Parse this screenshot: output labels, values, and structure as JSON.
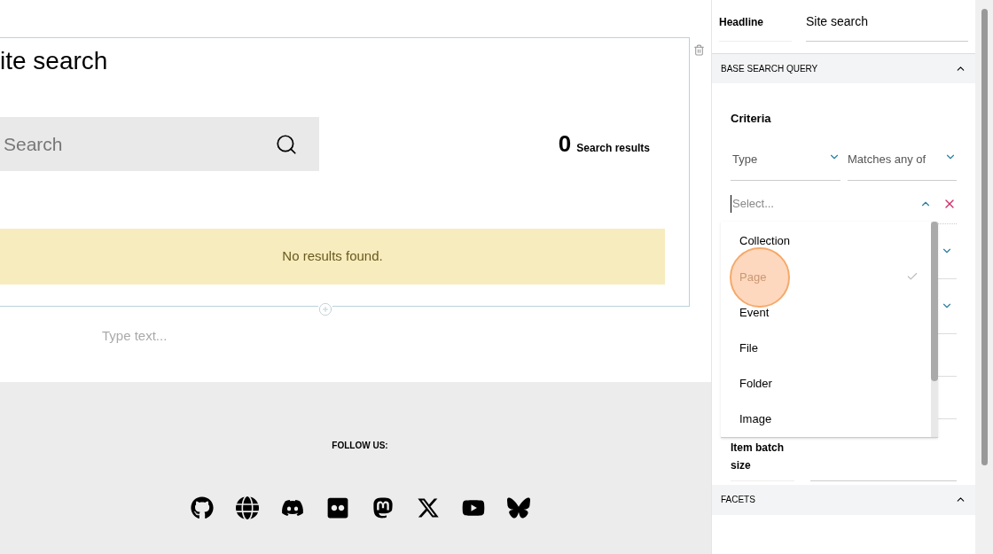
{
  "block": {
    "title": "ite search",
    "search": {
      "placeholder": "Search"
    },
    "result_count": "0",
    "result_label": "Search results",
    "empty_message": "No results found.",
    "text_placeholder": "Type text..."
  },
  "footer": {
    "follow_label": "FOLLOW US:",
    "social": [
      {
        "kind": "github"
      },
      {
        "kind": "globe"
      },
      {
        "kind": "discord"
      },
      {
        "kind": "flickr"
      },
      {
        "kind": "mastodon"
      },
      {
        "kind": "x"
      },
      {
        "kind": "youtube"
      },
      {
        "kind": "bluesky"
      }
    ]
  },
  "sidebar": {
    "headline_label": "Headline",
    "headline_value": "Site search",
    "section": "BASE SEARCH QUERY",
    "criteria_label": "Criteria",
    "field_select": "Type",
    "operator_select": "Matches any of",
    "value_placeholder": "Select...",
    "options": [
      {
        "label": "Collection",
        "selected": false
      },
      {
        "label": "Page",
        "selected": true
      },
      {
        "label": "Event",
        "selected": false
      },
      {
        "label": "File",
        "selected": false
      },
      {
        "label": "Folder",
        "selected": false
      },
      {
        "label": "Image",
        "selected": false
      }
    ],
    "batch_label": "Item batch size",
    "facets_section": "FACETS"
  }
}
